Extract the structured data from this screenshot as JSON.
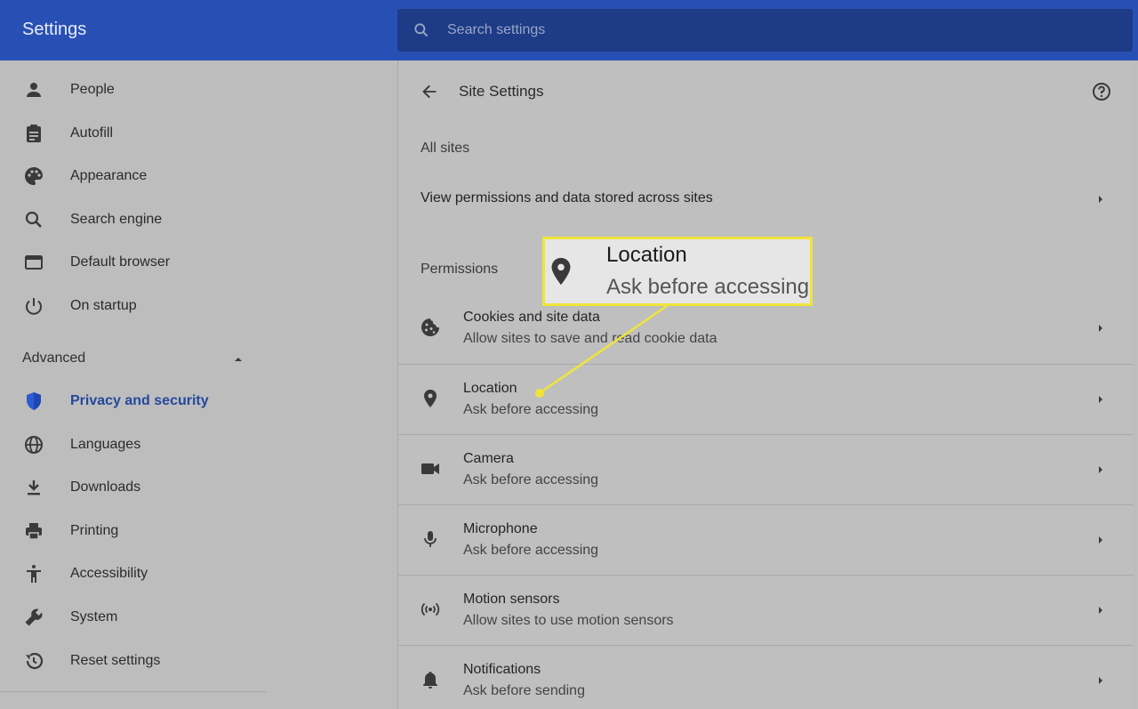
{
  "header": {
    "app_title": "Settings",
    "search_placeholder": "Search settings"
  },
  "sidebar": {
    "items": [
      {
        "label": "People",
        "icon": "person-icon"
      },
      {
        "label": "Autofill",
        "icon": "clipboard-icon"
      },
      {
        "label": "Appearance",
        "icon": "palette-icon"
      },
      {
        "label": "Search engine",
        "icon": "search-icon"
      },
      {
        "label": "Default browser",
        "icon": "browser-window-icon"
      },
      {
        "label": "On startup",
        "icon": "power-icon"
      }
    ],
    "advanced_label": "Advanced",
    "advanced_items": [
      {
        "label": "Privacy and security",
        "icon": "shield-icon",
        "active": true
      },
      {
        "label": "Languages",
        "icon": "globe-icon"
      },
      {
        "label": "Downloads",
        "icon": "download-icon"
      },
      {
        "label": "Printing",
        "icon": "printer-icon"
      },
      {
        "label": "Accessibility",
        "icon": "accessibility-icon"
      },
      {
        "label": "System",
        "icon": "wrench-icon"
      },
      {
        "label": "Reset settings",
        "icon": "restore-icon"
      }
    ]
  },
  "main": {
    "title": "Site Settings",
    "all_sites_label": "All sites",
    "all_sites_row": "View permissions and data stored across sites",
    "permissions_label": "Permissions",
    "permissions": [
      {
        "title": "Cookies and site data",
        "subtitle": "Allow sites to save and read cookie data",
        "icon": "cookie-icon"
      },
      {
        "title": "Location",
        "subtitle": "Ask before accessing",
        "icon": "location-pin-icon"
      },
      {
        "title": "Camera",
        "subtitle": "Ask before accessing",
        "icon": "camera-icon"
      },
      {
        "title": "Microphone",
        "subtitle": "Ask before accessing",
        "icon": "microphone-icon"
      },
      {
        "title": "Motion sensors",
        "subtitle": "Allow sites to use motion sensors",
        "icon": "motion-sensor-icon"
      },
      {
        "title": "Notifications",
        "subtitle": "Ask before sending",
        "icon": "bell-icon"
      }
    ]
  },
  "callout": {
    "title": "Location",
    "subtitle": "Ask before accessing",
    "border_color": "#f0e43a"
  },
  "colors": {
    "header": "#2850b4",
    "search_box": "#1d3b86",
    "active_nav": "#24489e",
    "active_icon": "#2d5bd0"
  }
}
